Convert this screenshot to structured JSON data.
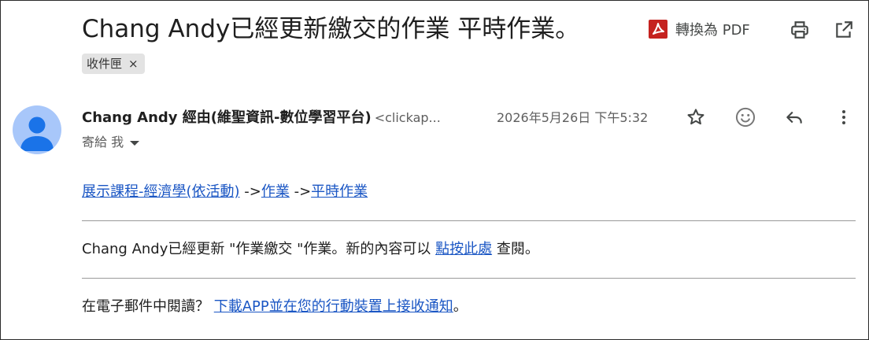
{
  "email": {
    "subject": "Chang Andy已經更新繳交的作業 平時作業。",
    "label_chip": {
      "label": "收件匣",
      "remove_symbol": "×"
    },
    "toolbar": {
      "pdf_label": "轉換為 PDF"
    },
    "sender": {
      "name": "Chang Andy 經由(維聖資訊-數位學習平台)",
      "email_truncated": "<clickap...",
      "date": "2026年5月26日 下午5:32"
    },
    "recipient_label": "寄給 我",
    "breadcrumb": {
      "course_link": "展示課程-經濟學(依活動)",
      "sep1": " ->",
      "assignments_link": "作業",
      "sep2": " ->",
      "assignment_link": "平時作業"
    },
    "message": {
      "text_before": "Chang Andy已經更新 \"作業繳交 \"作業。新的內容可以 ",
      "view_link": "點按此處",
      "text_after": " 查閱。"
    },
    "footer": {
      "text_before": "在電子郵件中閱讀？ ",
      "app_link": "下載APP並在您的行動裝置上接收通知",
      "text_after": "。"
    }
  },
  "colors": {
    "link": "#1a56c4",
    "pdf_red": "#c5221f",
    "avatar_bg": "#a8c7fa",
    "avatar_fg": "#1a73e8",
    "chip_bg": "#e3e3e3"
  },
  "icons": [
    "pdf-icon",
    "print-icon",
    "open-in-new-window-icon",
    "star-icon",
    "emoji-reaction-icon",
    "reply-icon",
    "more-vert-icon",
    "caret-down-icon",
    "person-icon"
  ]
}
